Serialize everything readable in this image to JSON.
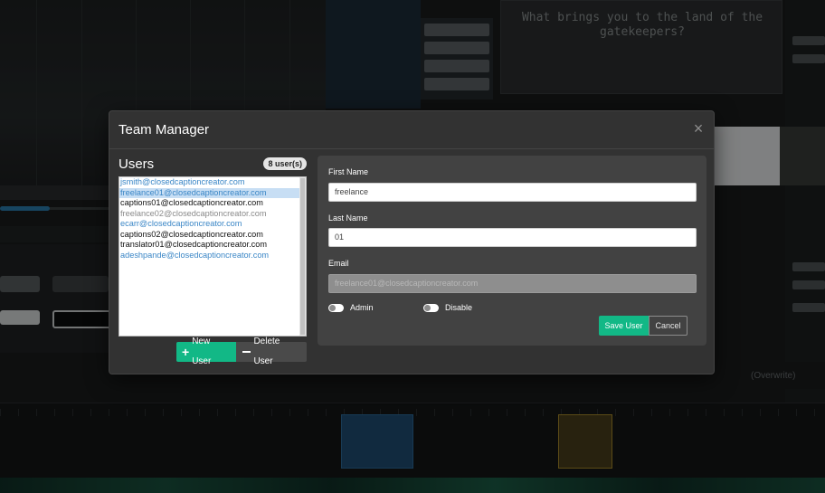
{
  "background": {
    "editor_text": "What brings you to the land of the gatekeepers?",
    "status_text": "(Overwrite)"
  },
  "modal": {
    "title": "Team Manager",
    "close_glyph": "×",
    "users_title": "Users",
    "users_count": "8 user(s)",
    "users": [
      {
        "email": "jsmith@closedcaptioncreator.com",
        "color": "#3a86c6",
        "selected": false
      },
      {
        "email": "freelance01@closedcaptioncreator.com",
        "color": "#3a86c6",
        "selected": true
      },
      {
        "email": "captions01@closedcaptioncreator.com",
        "color": "#111111",
        "selected": false
      },
      {
        "email": "freelance02@closedcaptioncreator.com",
        "color": "#8a8a8a",
        "selected": false
      },
      {
        "email": "ecarr@closedcaptioncreator.com",
        "color": "#3a86c6",
        "selected": false
      },
      {
        "email": "captions02@closedcaptioncreator.com",
        "color": "#111111",
        "selected": false
      },
      {
        "email": "translator01@closedcaptioncreator.com",
        "color": "#111111",
        "selected": false
      },
      {
        "email": "adeshpande@closedcaptioncreator.com",
        "color": "#3a86c6",
        "selected": false
      }
    ],
    "new_user_label": "New User",
    "delete_user_label": "Delete User",
    "form": {
      "first_name_label": "First Name",
      "first_name_value": "freelance",
      "last_name_label": "Last Name",
      "last_name_value": "01",
      "email_label": "Email",
      "email_value": "freelance01@closedcaptioncreator.com",
      "admin_label": "Admin",
      "disable_label": "Disable",
      "save_label": "Save User",
      "cancel_label": "Cancel"
    }
  },
  "colors": {
    "accent": "#12b886",
    "modal_bg": "#323232",
    "panel_bg": "#424242",
    "selected_row": "#c7def4"
  }
}
